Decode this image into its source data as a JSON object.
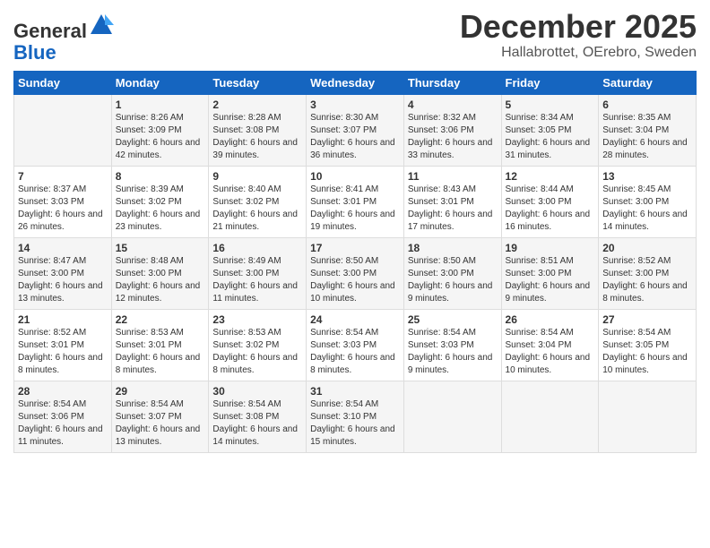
{
  "header": {
    "logo_general": "General",
    "logo_blue": "Blue",
    "main_title": "December 2025",
    "subtitle": "Hallabrottet, OErebro, Sweden"
  },
  "columns": [
    "Sunday",
    "Monday",
    "Tuesday",
    "Wednesday",
    "Thursday",
    "Friday",
    "Saturday"
  ],
  "weeks": [
    [
      {
        "day": "",
        "sunrise": "",
        "sunset": "",
        "daylight": ""
      },
      {
        "day": "1",
        "sunrise": "Sunrise: 8:26 AM",
        "sunset": "Sunset: 3:09 PM",
        "daylight": "Daylight: 6 hours and 42 minutes."
      },
      {
        "day": "2",
        "sunrise": "Sunrise: 8:28 AM",
        "sunset": "Sunset: 3:08 PM",
        "daylight": "Daylight: 6 hours and 39 minutes."
      },
      {
        "day": "3",
        "sunrise": "Sunrise: 8:30 AM",
        "sunset": "Sunset: 3:07 PM",
        "daylight": "Daylight: 6 hours and 36 minutes."
      },
      {
        "day": "4",
        "sunrise": "Sunrise: 8:32 AM",
        "sunset": "Sunset: 3:06 PM",
        "daylight": "Daylight: 6 hours and 33 minutes."
      },
      {
        "day": "5",
        "sunrise": "Sunrise: 8:34 AM",
        "sunset": "Sunset: 3:05 PM",
        "daylight": "Daylight: 6 hours and 31 minutes."
      },
      {
        "day": "6",
        "sunrise": "Sunrise: 8:35 AM",
        "sunset": "Sunset: 3:04 PM",
        "daylight": "Daylight: 6 hours and 28 minutes."
      }
    ],
    [
      {
        "day": "7",
        "sunrise": "Sunrise: 8:37 AM",
        "sunset": "Sunset: 3:03 PM",
        "daylight": "Daylight: 6 hours and 26 minutes."
      },
      {
        "day": "8",
        "sunrise": "Sunrise: 8:39 AM",
        "sunset": "Sunset: 3:02 PM",
        "daylight": "Daylight: 6 hours and 23 minutes."
      },
      {
        "day": "9",
        "sunrise": "Sunrise: 8:40 AM",
        "sunset": "Sunset: 3:02 PM",
        "daylight": "Daylight: 6 hours and 21 minutes."
      },
      {
        "day": "10",
        "sunrise": "Sunrise: 8:41 AM",
        "sunset": "Sunset: 3:01 PM",
        "daylight": "Daylight: 6 hours and 19 minutes."
      },
      {
        "day": "11",
        "sunrise": "Sunrise: 8:43 AM",
        "sunset": "Sunset: 3:01 PM",
        "daylight": "Daylight: 6 hours and 17 minutes."
      },
      {
        "day": "12",
        "sunrise": "Sunrise: 8:44 AM",
        "sunset": "Sunset: 3:00 PM",
        "daylight": "Daylight: 6 hours and 16 minutes."
      },
      {
        "day": "13",
        "sunrise": "Sunrise: 8:45 AM",
        "sunset": "Sunset: 3:00 PM",
        "daylight": "Daylight: 6 hours and 14 minutes."
      }
    ],
    [
      {
        "day": "14",
        "sunrise": "Sunrise: 8:47 AM",
        "sunset": "Sunset: 3:00 PM",
        "daylight": "Daylight: 6 hours and 13 minutes."
      },
      {
        "day": "15",
        "sunrise": "Sunrise: 8:48 AM",
        "sunset": "Sunset: 3:00 PM",
        "daylight": "Daylight: 6 hours and 12 minutes."
      },
      {
        "day": "16",
        "sunrise": "Sunrise: 8:49 AM",
        "sunset": "Sunset: 3:00 PM",
        "daylight": "Daylight: 6 hours and 11 minutes."
      },
      {
        "day": "17",
        "sunrise": "Sunrise: 8:50 AM",
        "sunset": "Sunset: 3:00 PM",
        "daylight": "Daylight: 6 hours and 10 minutes."
      },
      {
        "day": "18",
        "sunrise": "Sunrise: 8:50 AM",
        "sunset": "Sunset: 3:00 PM",
        "daylight": "Daylight: 6 hours and 9 minutes."
      },
      {
        "day": "19",
        "sunrise": "Sunrise: 8:51 AM",
        "sunset": "Sunset: 3:00 PM",
        "daylight": "Daylight: 6 hours and 9 minutes."
      },
      {
        "day": "20",
        "sunrise": "Sunrise: 8:52 AM",
        "sunset": "Sunset: 3:00 PM",
        "daylight": "Daylight: 6 hours and 8 minutes."
      }
    ],
    [
      {
        "day": "21",
        "sunrise": "Sunrise: 8:52 AM",
        "sunset": "Sunset: 3:01 PM",
        "daylight": "Daylight: 6 hours and 8 minutes."
      },
      {
        "day": "22",
        "sunrise": "Sunrise: 8:53 AM",
        "sunset": "Sunset: 3:01 PM",
        "daylight": "Daylight: 6 hours and 8 minutes."
      },
      {
        "day": "23",
        "sunrise": "Sunrise: 8:53 AM",
        "sunset": "Sunset: 3:02 PM",
        "daylight": "Daylight: 6 hours and 8 minutes."
      },
      {
        "day": "24",
        "sunrise": "Sunrise: 8:54 AM",
        "sunset": "Sunset: 3:03 PM",
        "daylight": "Daylight: 6 hours and 8 minutes."
      },
      {
        "day": "25",
        "sunrise": "Sunrise: 8:54 AM",
        "sunset": "Sunset: 3:03 PM",
        "daylight": "Daylight: 6 hours and 9 minutes."
      },
      {
        "day": "26",
        "sunrise": "Sunrise: 8:54 AM",
        "sunset": "Sunset: 3:04 PM",
        "daylight": "Daylight: 6 hours and 10 minutes."
      },
      {
        "day": "27",
        "sunrise": "Sunrise: 8:54 AM",
        "sunset": "Sunset: 3:05 PM",
        "daylight": "Daylight: 6 hours and 10 minutes."
      }
    ],
    [
      {
        "day": "28",
        "sunrise": "Sunrise: 8:54 AM",
        "sunset": "Sunset: 3:06 PM",
        "daylight": "Daylight: 6 hours and 11 minutes."
      },
      {
        "day": "29",
        "sunrise": "Sunrise: 8:54 AM",
        "sunset": "Sunset: 3:07 PM",
        "daylight": "Daylight: 6 hours and 13 minutes."
      },
      {
        "day": "30",
        "sunrise": "Sunrise: 8:54 AM",
        "sunset": "Sunset: 3:08 PM",
        "daylight": "Daylight: 6 hours and 14 minutes."
      },
      {
        "day": "31",
        "sunrise": "Sunrise: 8:54 AM",
        "sunset": "Sunset: 3:10 PM",
        "daylight": "Daylight: 6 hours and 15 minutes."
      },
      {
        "day": "",
        "sunrise": "",
        "sunset": "",
        "daylight": ""
      },
      {
        "day": "",
        "sunrise": "",
        "sunset": "",
        "daylight": ""
      },
      {
        "day": "",
        "sunrise": "",
        "sunset": "",
        "daylight": ""
      }
    ]
  ]
}
